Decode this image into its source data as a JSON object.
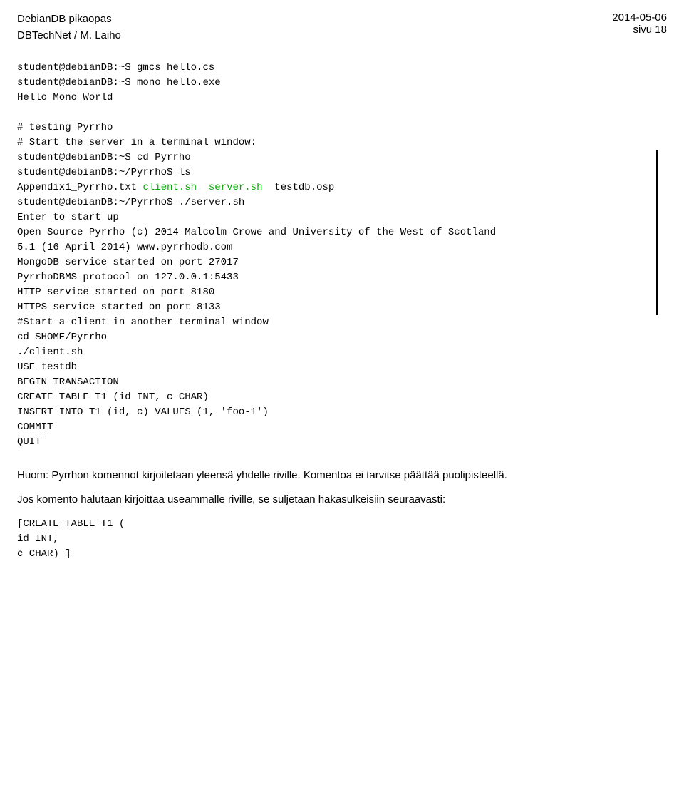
{
  "header": {
    "title_line1": "DebianDB pikaopas",
    "title_line2": "DBTechNet / M. Laiho",
    "date": "2014-05-06",
    "page": "sivu 18"
  },
  "terminal_block1": {
    "lines": [
      "student@debianDB:~$ gmcs hello.cs",
      "student@debianDB:~$ mono hello.exe",
      "Hello Mono World",
      "",
      "# testing Pyrrho",
      "# Start the server in a terminal window:"
    ]
  },
  "terminal_block2_bordered": {
    "lines_normal": [
      "student@debianDB:~$ cd Pyrrho",
      "student@debianDB:~/Pyrrho$ ls"
    ],
    "line_mixed_prefix": "Appendix1_Pyrrho.txt ",
    "line_mixed_green": "client.sh  server.sh",
    "line_mixed_suffix": "  testdb.osp",
    "lines_after": [
      "student@debianDB:~/Pyrrho$ ./server.sh",
      "Enter to start up",
      "Open Source Pyrrho (c) 2014 Malcolm Crowe and University of the West of Scotland",
      "5.1 (16 April 2014) www.pyrrhodb.com",
      "MongoDB service started on port 27017",
      "PyrrhoDBMS protocol on 127.0.0.1:5433",
      "HTTP service started on port 8180",
      "HTTPS service started on port 8133"
    ]
  },
  "terminal_block3": {
    "lines": [
      "",
      "#Start a client in another terminal window",
      "cd $HOME/Pyrrho",
      "./client.sh",
      "USE testdb",
      "BEGIN TRANSACTION",
      "CREATE TABLE T1 (id INT, c CHAR)",
      "INSERT INTO T1 (id, c) VALUES (1, 'foo-1')",
      "COMMIT",
      "QUIT"
    ]
  },
  "prose": {
    "line1": "Huom:  Pyrrhon komennot kirjoitetaan yleensä yhdelle riville.  Komentoa ei tarvitse päättää puolipisteellä.",
    "line2": "Jos komento halutaan kirjoittaa useammalle riville, se suljetaan hakasulkeisiin seuraavasti:"
  },
  "code_multiline": {
    "lines": [
      "[CREATE TABLE T1 (",
      "id INT,",
      "c CHAR) ]"
    ]
  }
}
